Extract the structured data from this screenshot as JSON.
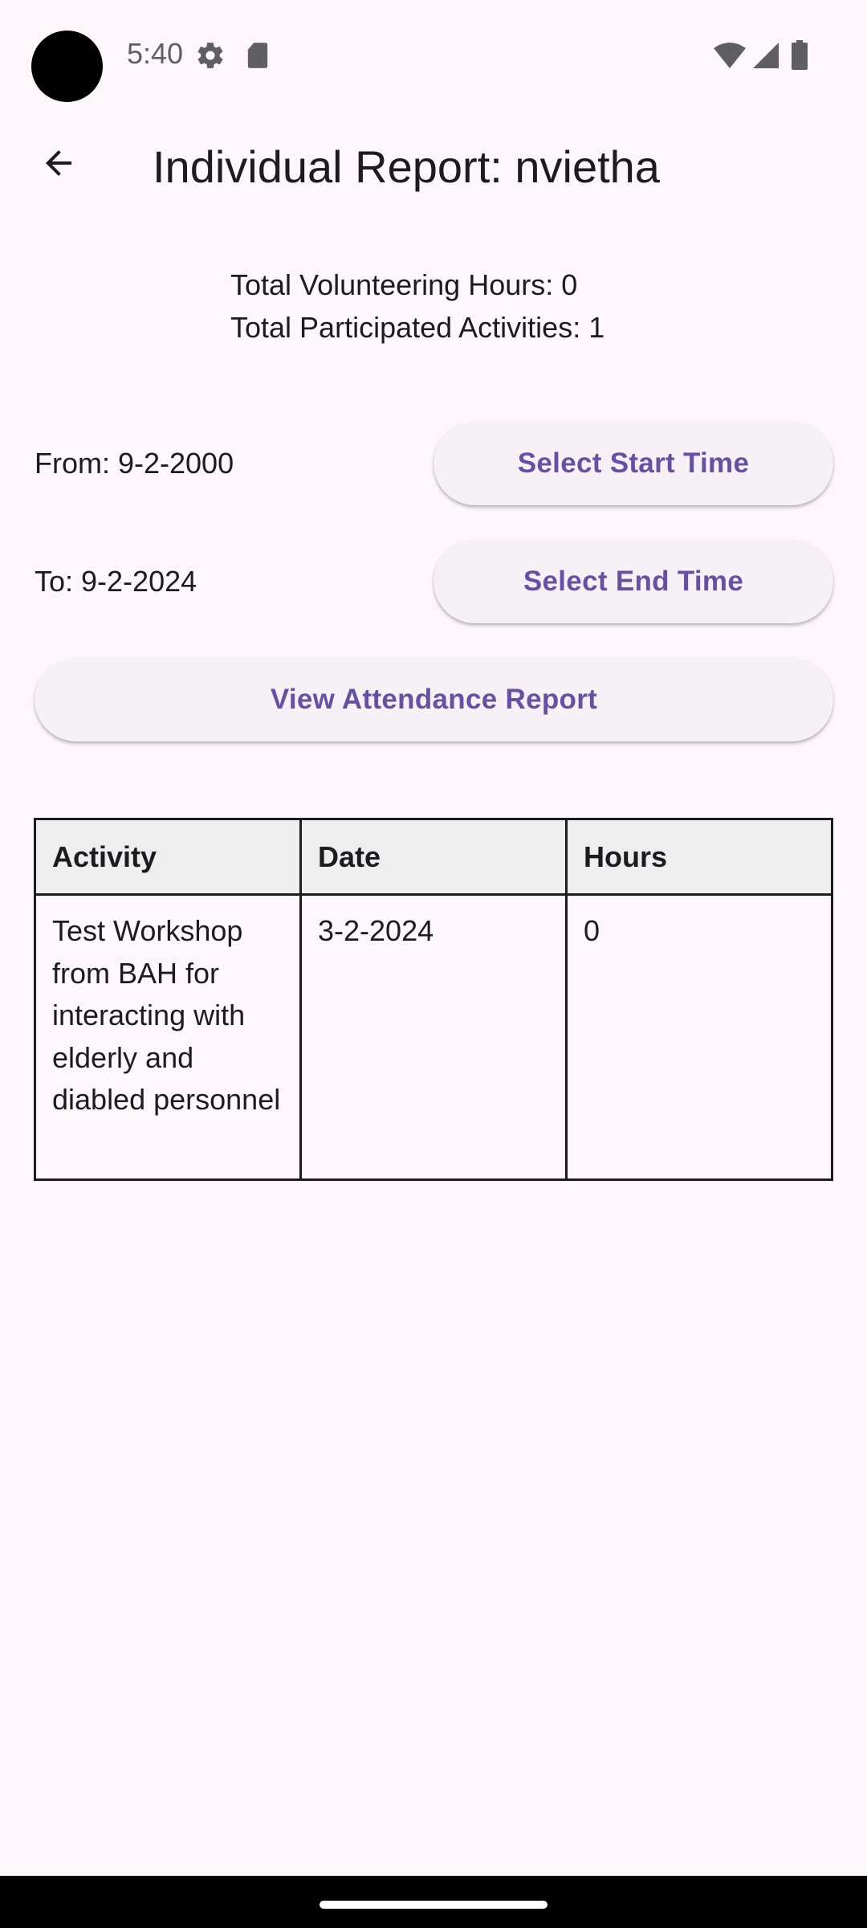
{
  "status_bar": {
    "time": "5:40",
    "icons": [
      "settings-gear-icon",
      "sd-card-icon",
      "wifi-icon",
      "cellular-signal-icon",
      "battery-icon"
    ]
  },
  "app_bar": {
    "back_icon": "arrow-back-icon",
    "title": "Individual Report: nvietha"
  },
  "summary": {
    "total_hours": "Total Volunteering Hours: 0",
    "total_activities": "Total Participated Activities: 1"
  },
  "date_range": {
    "from_label": "From: 9-2-2000",
    "to_label": "To: 9-2-2024",
    "start_button": "Select Start Time",
    "end_button": "Select End Time"
  },
  "view_button": "View Attendance Report",
  "table": {
    "headers": [
      "Activity",
      "Date",
      "Hours"
    ],
    "rows": [
      [
        "Test Workshop from BAH for interacting with elderly and diabled personnel",
        "3-2-2024",
        "0"
      ]
    ]
  },
  "colors": {
    "background": "#fdf7fb",
    "accent": "#6750a4",
    "button_bg": "#f6f0f7",
    "header_bg": "#eeeeee"
  }
}
